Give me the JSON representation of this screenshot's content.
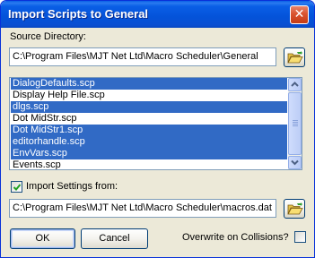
{
  "window": {
    "title": "Import Scripts to General",
    "close_glyph": "✕"
  },
  "source": {
    "label": "Source Directory:",
    "path": "C:\\Program Files\\MJT Net Ltd\\Macro Scheduler\\General",
    "browse_icon": "folder-open-icon"
  },
  "scripts": {
    "items": [
      {
        "label": "DialogDefaults.scp",
        "selected": true
      },
      {
        "label": "Display Help File.scp",
        "selected": false
      },
      {
        "label": "dlgs.scp",
        "selected": true
      },
      {
        "label": "Dot MidStr.scp",
        "selected": false
      },
      {
        "label": "Dot MidStr1.scp",
        "selected": true
      },
      {
        "label": "editorhandle.scp",
        "selected": true
      },
      {
        "label": "EnvVars.scp",
        "selected": true
      },
      {
        "label": "Events.scp",
        "selected": false
      }
    ]
  },
  "import_settings": {
    "label": "Import Settings from:",
    "checked": true,
    "path": "C:\\Program Files\\MJT Net Ltd\\Macro Scheduler\\macros.dat",
    "browse_icon": "folder-open-icon"
  },
  "buttons": {
    "ok": "OK",
    "cancel": "Cancel"
  },
  "overwrite": {
    "label": "Overwrite on Collisions?",
    "checked": false
  },
  "colors": {
    "selection": "#316ac5",
    "face": "#ece9d8",
    "titlebar": "#0453d9"
  }
}
